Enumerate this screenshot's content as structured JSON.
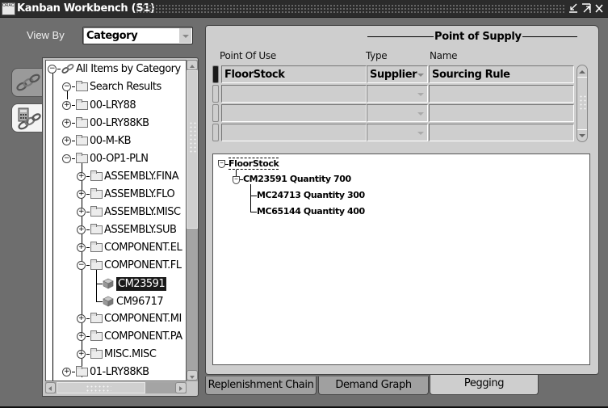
{
  "window": {
    "title": "Kanban Workbench (S1)",
    "icon_label": "ORACLE",
    "controls": [
      "minimize-icon",
      "maximize-icon",
      "close-icon"
    ]
  },
  "view_by": {
    "label": "View By",
    "selected": "Category"
  },
  "side_tabs": [
    {
      "icon": "chain-links-icon",
      "active": false
    },
    {
      "icon": "calculator-chain-icon",
      "active": true
    }
  ],
  "tree": {
    "items": [
      {
        "label": "All Items by Category",
        "level": 0,
        "state": "expanded",
        "icon": "chain-icon"
      },
      {
        "label": "Search Results",
        "level": 1,
        "state": "expanded",
        "icon": "folder-icon"
      },
      {
        "label": "00-LRY88",
        "level": 1,
        "state": "collapsed",
        "icon": "folder-icon"
      },
      {
        "label": "00-LRY88KB",
        "level": 1,
        "state": "collapsed",
        "icon": "folder-icon"
      },
      {
        "label": "00-M-KB",
        "level": 1,
        "state": "collapsed",
        "icon": "folder-icon"
      },
      {
        "label": "00-OP1-PLN",
        "level": 1,
        "state": "expanded",
        "icon": "folder-icon"
      },
      {
        "label": "ASSEMBLY.FINA",
        "level": 2,
        "state": "collapsed",
        "icon": "folder-icon"
      },
      {
        "label": "ASSEMBLY.FLO",
        "level": 2,
        "state": "collapsed",
        "icon": "folder-icon"
      },
      {
        "label": "ASSEMBLY.MISC",
        "level": 2,
        "state": "collapsed",
        "icon": "folder-icon"
      },
      {
        "label": "ASSEMBLY.SUB",
        "level": 2,
        "state": "collapsed",
        "icon": "folder-icon"
      },
      {
        "label": "COMPONENT.EL",
        "level": 2,
        "state": "collapsed",
        "icon": "folder-icon"
      },
      {
        "label": "COMPONENT.FL",
        "level": 2,
        "state": "expanded",
        "icon": "folder-icon"
      },
      {
        "label": "CM23591",
        "level": 3,
        "state": "leaf",
        "icon": "item-cube-icon",
        "selected": true
      },
      {
        "label": "CM96717",
        "level": 3,
        "state": "leaf",
        "icon": "item-cube-icon"
      },
      {
        "label": "COMPONENT.MI",
        "level": 2,
        "state": "collapsed",
        "icon": "folder-icon"
      },
      {
        "label": "COMPONENT.PA",
        "level": 2,
        "state": "collapsed",
        "icon": "folder-icon"
      },
      {
        "label": "MISC.MISC",
        "level": 2,
        "state": "collapsed",
        "icon": "folder-icon"
      },
      {
        "label": "01-LRY88KB",
        "level": 1,
        "state": "collapsed",
        "icon": "folder-icon"
      }
    ]
  },
  "grid": {
    "group_header": "Point of Supply",
    "columns": {
      "point_of_use": "Point Of Use",
      "type": "Type",
      "name": "Name"
    },
    "rows": [
      {
        "point_of_use": "FloorStock",
        "type": "Supplier",
        "name": "Sourcing Rule",
        "active": true
      },
      {
        "point_of_use": "",
        "type": "",
        "name": ""
      },
      {
        "point_of_use": "",
        "type": "",
        "name": ""
      },
      {
        "point_of_use": "",
        "type": "",
        "name": ""
      }
    ]
  },
  "pegging": {
    "root": "FloorStock",
    "child": "CM23591 Quantity 700",
    "grandchildren": [
      "MC24713 Quantity 300",
      "MC65144 Quantity 400"
    ]
  },
  "tabs": [
    {
      "label": "Replenishment Chain",
      "active": false
    },
    {
      "label": "Demand Graph",
      "active": false
    },
    {
      "label": "Pegging",
      "active": true
    }
  ]
}
